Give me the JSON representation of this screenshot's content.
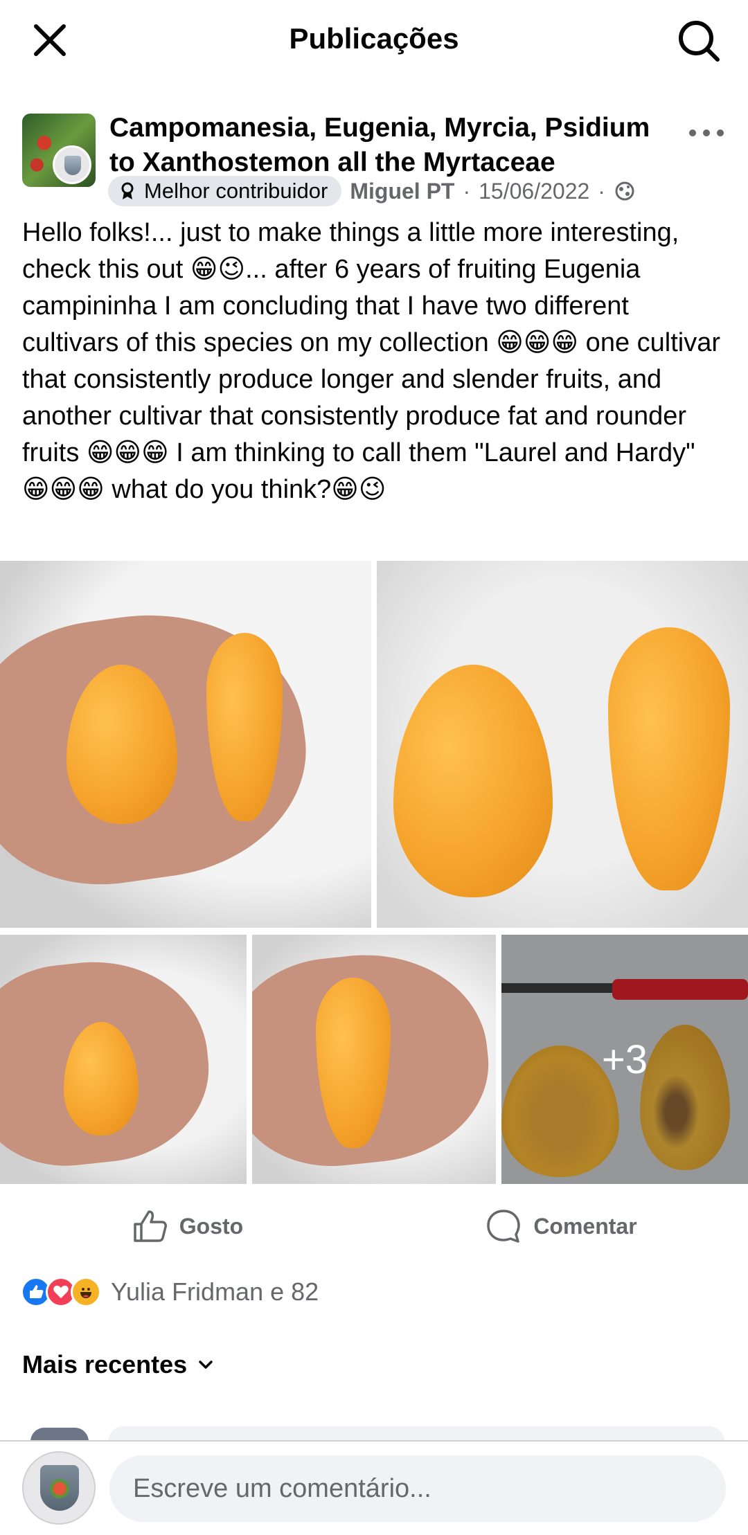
{
  "topbar": {
    "title": "Publicações",
    "close_icon": "close-icon",
    "search_icon": "search-icon"
  },
  "post": {
    "group_name": "Campomanesia, Eugenia, Myrcia, Psidium to Xanthostemon all the Myrtaceae",
    "badge_label": "Melhor contribuidor",
    "author": "Miguel PT",
    "date_sep": "·",
    "date": "15/06/2022",
    "privacy_icon": "globe-icon",
    "more_icon": "more-options-icon",
    "text": "Hello folks!... just to make things a little more interesting, check this out 😁😉... after 6 years of fruiting Eugenia campininha I am concluding that I have two different cultivars of this species on my collection 😁😁😁 one cultivar that consistently produce longer and slender fruits, and another cultivar that consistently produce fat and rounder fruits 😁😁😁 I am thinking to call them \"Laurel and Hardy\" 😁😁😁 what do you think?😁😉",
    "photos": {
      "more_count": "+3"
    }
  },
  "actions": {
    "like_label": "Gosto",
    "comment_label": "Comentar"
  },
  "reactions": {
    "types": [
      "like",
      "love",
      "haha"
    ],
    "summary": "Yulia Fridman e 82"
  },
  "comments": {
    "sort_label": "Mais recentes",
    "composer_placeholder": "Escreve um comentário..."
  },
  "colors": {
    "brand_blue": "#1877f2",
    "love_red": "#f33e58",
    "haha_yellow": "#f7b125",
    "secondary_text": "#65676b"
  }
}
